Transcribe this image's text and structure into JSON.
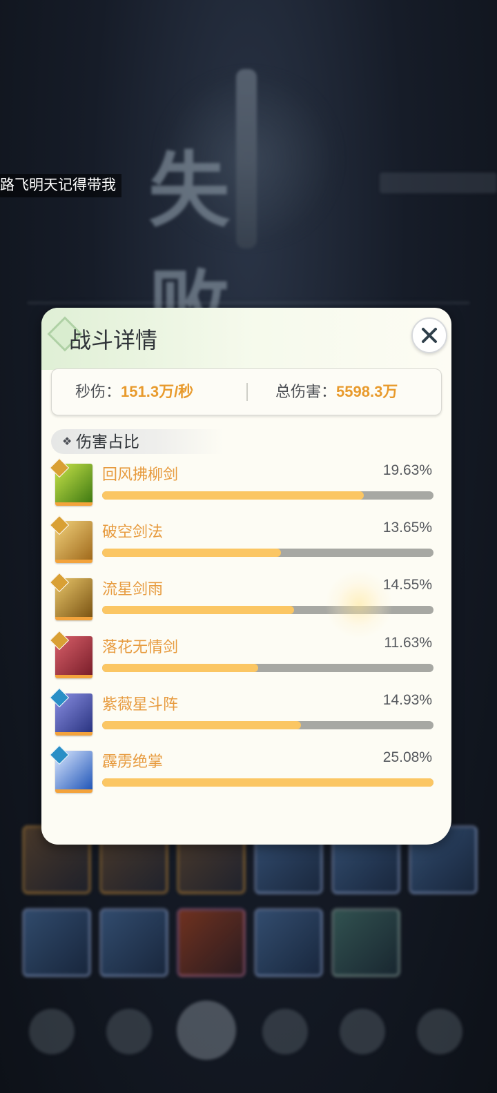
{
  "background": {
    "defeat_title": "失败",
    "player_name": "路飞明天记得带我"
  },
  "panel": {
    "title": "战斗详情",
    "close_icon": "close-icon",
    "stats": {
      "dps_label": "秒伤：",
      "dps_value": "151.3万/秒",
      "total_label": "总伤害：",
      "total_value": "5598.3万"
    },
    "section_title": "伤害占比",
    "section_bullet": "❖",
    "skills": [
      {
        "name": "回风拂柳剑",
        "percent": "19.63%",
        "fill": 0.79,
        "icon": "wind-sword-icon",
        "badge": "gold",
        "colors": [
          "#c9e44a",
          "#3f7a12"
        ]
      },
      {
        "name": "破空剑法",
        "percent": "13.65%",
        "fill": 0.54,
        "icon": "void-sword-icon",
        "badge": "gold",
        "colors": [
          "#f2d27c",
          "#a06a1c"
        ]
      },
      {
        "name": "流星剑雨",
        "percent": "14.55%",
        "fill": 0.58,
        "icon": "meteor-sword-icon",
        "badge": "gold",
        "colors": [
          "#e9c66a",
          "#7b5413"
        ]
      },
      {
        "name": "落花无情剑",
        "percent": "11.63%",
        "fill": 0.47,
        "icon": "falling-petal-sword-icon",
        "badge": "gold",
        "colors": [
          "#d9606a",
          "#7a1e2a"
        ]
      },
      {
        "name": "紫薇星斗阵",
        "percent": "14.93%",
        "fill": 0.6,
        "icon": "star-formation-icon",
        "badge": "blue",
        "colors": [
          "#8a8fe3",
          "#2a3481"
        ]
      },
      {
        "name": "霹雳绝掌",
        "percent": "25.08%",
        "fill": 1.0,
        "icon": "thunder-palm-icon",
        "badge": "blue",
        "colors": [
          "#dbe8ff",
          "#2156b8"
        ]
      }
    ]
  },
  "colors": {
    "accent_orange": "#e89a2c",
    "bar_fill": "#fbc663",
    "bar_track": "#a7a8a3",
    "panel_bg": "#fdfcf4"
  }
}
